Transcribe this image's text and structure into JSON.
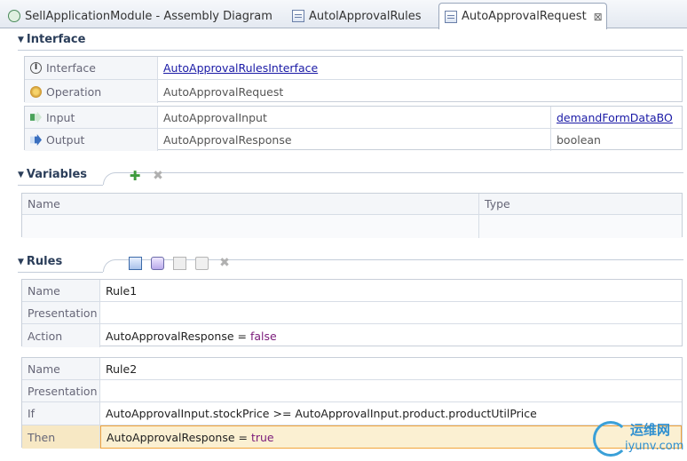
{
  "tabs": [
    {
      "label": "SellApplicationModule - Assembly Diagram",
      "icon": "assembly-diagram-icon",
      "active": false
    },
    {
      "label": "AutolApprovalRules",
      "icon": "rule-group-icon",
      "active": false
    },
    {
      "label": "AutoApprovalRequest",
      "icon": "rule-group-icon",
      "active": true,
      "close": "⊠"
    }
  ],
  "interface_section": {
    "title": "Interface",
    "rows": [
      {
        "label": "Interface",
        "value": "AutoApprovalRulesInterface"
      },
      {
        "label": "Operation",
        "value": "AutoApprovalRequest"
      }
    ],
    "io_rows": [
      {
        "label": "Input",
        "value": "AutoApprovalInput",
        "type": "demandFormDataBO"
      },
      {
        "label": "Output",
        "value": "AutoApprovalResponse",
        "type": "boolean"
      }
    ]
  },
  "variables_section": {
    "title": "Variables",
    "columns": [
      "Name",
      "Type"
    ]
  },
  "rules_section": {
    "title": "Rules",
    "rule1": {
      "name_label": "Name",
      "name": "Rule1",
      "presentation_label": "Presentation",
      "presentation": "",
      "action_label": "Action",
      "action_prefix": "AutoApprovalResponse = ",
      "action_value": "false"
    },
    "rule2": {
      "name_label": "Name",
      "name": "Rule2",
      "presentation_label": "Presentation",
      "presentation": "",
      "if_label": "If",
      "if_expr": "AutoApprovalInput.stockPrice >= AutoApprovalInput.product.productUtilPrice",
      "then_label": "Then",
      "then_prefix": "AutoApprovalResponse = ",
      "then_value": "true"
    }
  },
  "watermark": {
    "top": "运维网",
    "bottom": "iyunv.com"
  },
  "colors": {
    "link": "#1a1aa6",
    "keyword": "#7a1a7a",
    "highlight": "#fbf0d2",
    "add_icon": "#3d9a3d"
  }
}
